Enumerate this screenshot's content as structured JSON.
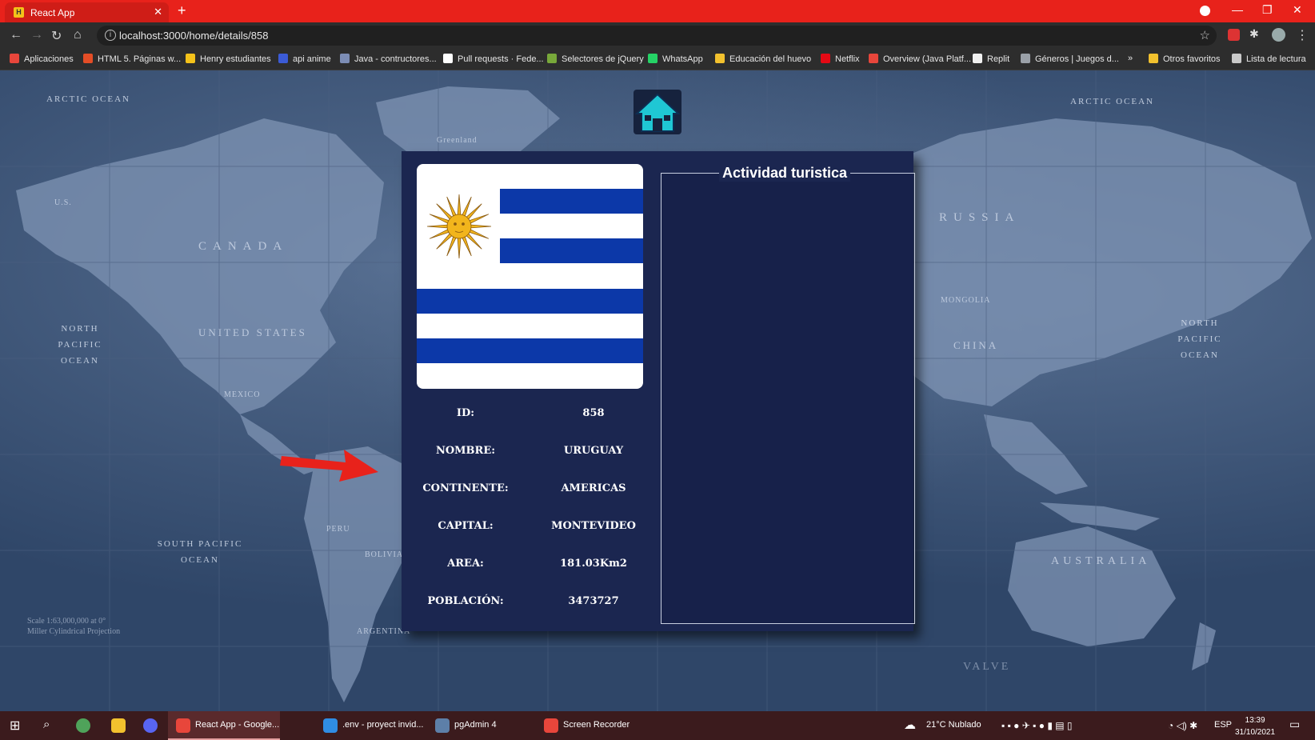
{
  "browser": {
    "tab_title": "React App",
    "tab_favicon_letter": "H",
    "url": "localhost:3000/home/details/858",
    "bookmarks": [
      {
        "label": "Aplicaciones",
        "color": "#e8463b"
      },
      {
        "label": "HTML 5. Páginas w...",
        "color": "#e44d26"
      },
      {
        "label": "Henry estudiantes",
        "color": "#f4c21a"
      },
      {
        "label": "api anime",
        "color": "#3b5bd6"
      },
      {
        "label": "Java - contructores...",
        "color": "#7c8db5"
      },
      {
        "label": "Pull requests · Fede...",
        "color": "#ffffff"
      },
      {
        "label": "Selectores de jQuery",
        "color": "#78a83a"
      },
      {
        "label": "WhatsApp",
        "color": "#25d366"
      },
      {
        "label": "Educación del huevo",
        "color": "#f2c12e"
      },
      {
        "label": "Netflix",
        "color": "#e50914"
      },
      {
        "label": "Overview (Java Platf...",
        "color": "#e8463b"
      },
      {
        "label": "Replit",
        "color": "#f0f0f0"
      },
      {
        "label": "Géneros | Juegos d...",
        "color": "#9aa0a8"
      },
      {
        "label": "»",
        "color": ""
      },
      {
        "label": "Otros favoritos",
        "color": "#f2c12e"
      },
      {
        "label": "Lista de lectura",
        "color": "#c9c9c9"
      }
    ]
  },
  "map_labels": {
    "arctic_ocean_left": "ARCTIC OCEAN",
    "arctic_ocean_right": "ARCTIC OCEAN",
    "greenland": "Greenland",
    "us_alaska": "U.S.",
    "canada": "CANADA",
    "russia": "RUSSIA",
    "united_states": "UNITED STATES",
    "mongolia": "MONGOLIA",
    "china": "CHINA",
    "mexico": "MEXICO",
    "north_pacific_left": [
      "NORTH",
      "PACIFIC",
      "OCEAN"
    ],
    "north_pacific_right": [
      "NORTH",
      "PACIFIC",
      "OCEAN"
    ],
    "south_pacific": [
      "SOUTH PACIFIC",
      "OCEAN"
    ],
    "peru": "PERU",
    "bolivia": "BOLIVIA",
    "argentina": "ARGENTINA",
    "australia": "AUSTRALIA",
    "valve": "VALVE",
    "scale": [
      "Scale 1:63,000,000 at 0°",
      "Miller Cylindrical Projection"
    ]
  },
  "details": {
    "flag_alt": "Uruguay flag",
    "rows": [
      {
        "label": "ID:",
        "value": "858"
      },
      {
        "label": "NOMBRE:",
        "value": "URUGUAY"
      },
      {
        "label": "CONTINENTE:",
        "value": "AMERICAS"
      },
      {
        "label": "CAPITAL:",
        "value": "MONTEVIDEO"
      },
      {
        "label": "AREA:",
        "value": "181.03Km2"
      },
      {
        "label": "POBLACIÓN:",
        "value": "3473727"
      }
    ],
    "activity_title": "Actividad turistica"
  },
  "taskbar": {
    "items": [
      {
        "label": "React App - Google...",
        "color": "#e8463b"
      },
      {
        "label": ".env - proyect invid...",
        "color": "#2f8de4"
      },
      {
        "label": "pgAdmin 4",
        "color": "#5d7fa8"
      },
      {
        "label": "Screen Recorder",
        "color": "#e8463b"
      }
    ],
    "weather": "21°C  Nublado",
    "language": "ESP",
    "time": "13:39",
    "date": "31/10/2021"
  },
  "colors": {
    "card_bg": "#1b2650",
    "flag_blue": "#0c38a8",
    "flag_sun": "#f2b51c",
    "home_icon": "#1fc7d4",
    "chrome_red": "#e8221b"
  }
}
